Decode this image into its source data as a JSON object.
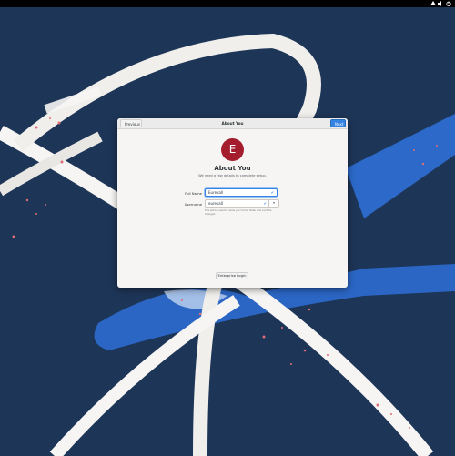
{
  "top_bar": {
    "icons": [
      "network-icon",
      "volume-icon",
      "power-icon"
    ]
  },
  "window": {
    "title": "About You",
    "previous_label": "Previous",
    "next_label": "Next",
    "avatar_letter": "E",
    "heading": "About You",
    "subheading": "We need a few details to complete setup.",
    "full_name": {
      "label": "Full Name",
      "value": "Eurekall"
    },
    "username": {
      "label": "Username",
      "value": "eurekall",
      "hint": "This will be used to name your home folder and can't be changed."
    },
    "enterprise_login_label": "Enterprise Login"
  },
  "colors": {
    "desktop_background": "#1d3557",
    "accent": "#3584e4",
    "avatar": "#a51d2d"
  }
}
